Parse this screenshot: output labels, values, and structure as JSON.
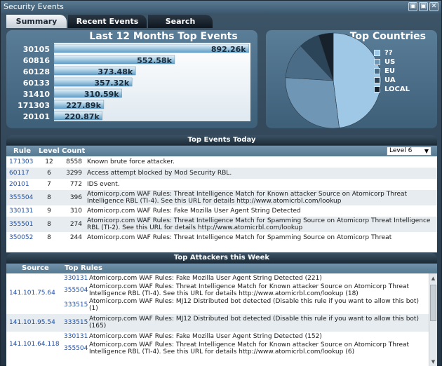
{
  "window": {
    "title": "Security Events",
    "btn_minimize": "▣",
    "btn_maximize": "▣",
    "btn_close": "✕"
  },
  "tabs": [
    {
      "label": "Summary",
      "active": true
    },
    {
      "label": "Recent Events",
      "active": false
    },
    {
      "label": "Search",
      "active": false
    }
  ],
  "chart_data": [
    {
      "type": "bar",
      "title": "Last 12 Months Top Events",
      "categories": [
        "30105",
        "60816",
        "60128",
        "60133",
        "31410",
        "171303",
        "20101"
      ],
      "values": [
        892.26,
        552.58,
        373.48,
        357.32,
        310.59,
        227.89,
        220.87
      ],
      "data_labels": [
        "892.26k",
        "552.58k",
        "373.48k",
        "357.32k",
        "310.59k",
        "227.89k",
        "220.87k"
      ],
      "xlim": [
        0,
        900
      ],
      "colors": {
        "bar_top": "#e8f4fb",
        "bar_bottom": "#5f9ec7",
        "bg": "#ffffff"
      }
    },
    {
      "type": "pie",
      "title": "Top Countries",
      "categories": [
        "??",
        "US",
        "EU",
        "UA",
        "LOCAL"
      ],
      "values": [
        48,
        28,
        12,
        7,
        5
      ],
      "colors": [
        "#9fc7e6",
        "#6f97b5",
        "#4b6c86",
        "#2c4457",
        "#16212b"
      ],
      "legend_position": "right"
    }
  ],
  "top_events_today": {
    "title": "Top Events Today",
    "col_rule": "Rule",
    "col_level": "Level",
    "col_count": "Count",
    "level_select": "Level 6",
    "level_arrow": "▼",
    "rows": [
      {
        "rule": "171303",
        "level": "12",
        "count": "8558",
        "desc": "Known brute force attacker."
      },
      {
        "rule": "60117",
        "level": "6",
        "count": "3299",
        "desc": "Access attempt blocked by Mod Security RBL."
      },
      {
        "rule": "20101",
        "level": "7",
        "count": "772",
        "desc": "IDS event."
      },
      {
        "rule": "355504",
        "level": "8",
        "count": "396",
        "desc": "Atomicorp.com WAF Rules: Threat Intelligence Match for Known attacker Source on Atomicorp Threat Intelligence RBL (TI-4). See this URL for details http://www.atomicrbl.com/lookup"
      },
      {
        "rule": "330131",
        "level": "9",
        "count": "310",
        "desc": "Atomicorp.com WAF Rules: Fake Mozilla User Agent String Detected"
      },
      {
        "rule": "355501",
        "level": "8",
        "count": "274",
        "desc": "Atomicorp.com WAF Rules: Threat Intelligence Match for Spamming Source on Atomicorp Threat Intelligence RBL (TI-2). See this URL for details http://www.atomicrbl.com/lookup"
      },
      {
        "rule": "350052",
        "level": "8",
        "count": "244",
        "desc": "Atomicorp.com WAF Rules: Threat Intelligence Match for Spamming Source on Atomicorp Threat"
      }
    ]
  },
  "top_attackers": {
    "title": "Top Attackers this Week",
    "col_source": "Source",
    "col_top_rules": "Top Rules",
    "scroll_up": "▲",
    "scroll_down": "▼",
    "groups": [
      {
        "source": "141.101.75.64",
        "rules": [
          {
            "rule": "330131",
            "desc": "Atomicorp.com WAF Rules: Fake Mozilla User Agent String Detected (221)"
          },
          {
            "rule": "355504",
            "desc": "Atomicorp.com WAF Rules: Threat Intelligence Match for Known attacker Source on Atomicorp Threat Intelligence RBL (TI-4). See this URL for details http://www.atomicrbl.com/lookup (18)"
          },
          {
            "rule": "333515",
            "desc": "Atomicorp.com WAF Rules: MJ12 Distributed bot detected (Disable this rule if you want to allow this bot) (1)"
          }
        ]
      },
      {
        "source": "141.101.95.54",
        "rules": [
          {
            "rule": "333515",
            "desc": "Atomicorp.com WAF Rules: MJ12 Distributed bot detected (Disable this rule if you want to allow this bot) (165)"
          }
        ]
      },
      {
        "source": "141.101.64.118",
        "rules": [
          {
            "rule": "330131",
            "desc": "Atomicorp.com WAF Rules: Fake Mozilla User Agent String Detected (152)"
          },
          {
            "rule": "355504",
            "desc": "Atomicorp.com WAF Rules: Threat Intelligence Match for Known attacker Source on Atomicorp Threat Intelligence RBL (TI-4). See this URL for details http://www.atomicrbl.com/lookup (6)"
          }
        ]
      }
    ]
  }
}
